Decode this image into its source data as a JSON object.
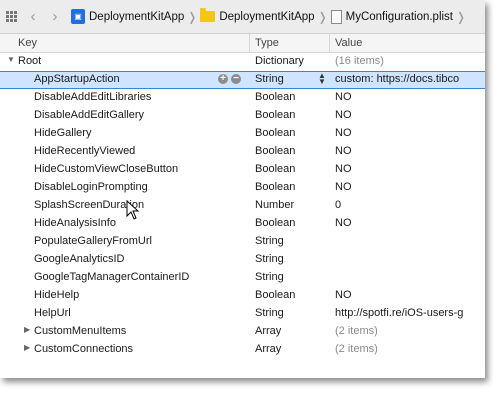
{
  "breadcrumb": {
    "project": "DeploymentKitApp",
    "group": "DeploymentKitApp",
    "file": "MyConfiguration.plist"
  },
  "columns": {
    "key": "Key",
    "type": "Type",
    "value": "Value"
  },
  "root": {
    "key": "Root",
    "type": "Dictionary",
    "value": "(16 items)"
  },
  "rows": [
    {
      "key": "AppStartupAction",
      "type": "String",
      "value": "custom: https://docs.tibco"
    },
    {
      "key": "DisableAddEditLibraries",
      "type": "Boolean",
      "value": "NO"
    },
    {
      "key": "DisableAddEditGallery",
      "type": "Boolean",
      "value": "NO"
    },
    {
      "key": "HideGallery",
      "type": "Boolean",
      "value": "NO"
    },
    {
      "key": "HideRecentlyViewed",
      "type": "Boolean",
      "value": "NO"
    },
    {
      "key": "HideCustomViewCloseButton",
      "type": "Boolean",
      "value": "NO"
    },
    {
      "key": "DisableLoginPrompting",
      "type": "Boolean",
      "value": "NO"
    },
    {
      "key": "SplashScreenDuration",
      "type": "Number",
      "value": "0"
    },
    {
      "key": "HideAnalysisInfo",
      "type": "Boolean",
      "value": "NO"
    },
    {
      "key": "PopulateGalleryFromUrl",
      "type": "String",
      "value": ""
    },
    {
      "key": "GoogleAnalyticsID",
      "type": "String",
      "value": ""
    },
    {
      "key": "GoogleTagManagerContainerID",
      "type": "String",
      "value": ""
    },
    {
      "key": "HideHelp",
      "type": "Boolean",
      "value": "NO"
    },
    {
      "key": "HelpUrl",
      "type": "String",
      "value": "http://spotfi.re/iOS-users-g"
    },
    {
      "key": "CustomMenuItems",
      "type": "Array",
      "value": "(2 items)"
    },
    {
      "key": "CustomConnections",
      "type": "Array",
      "value": "(2 items)"
    }
  ],
  "colors": {
    "selection": "#cfe4ff",
    "selection_border": "#3b84d9",
    "project_icon": "#1f6fe0",
    "folder_icon": "#f5c518"
  },
  "icons": [
    "grid-icon",
    "back-arrow-icon",
    "forward-arrow-icon",
    "project-icon",
    "folder-icon",
    "plist-file-icon",
    "disclosure-triangle-icon",
    "add-icon",
    "remove-icon",
    "stepper-icon",
    "mouse-cursor-icon"
  ]
}
